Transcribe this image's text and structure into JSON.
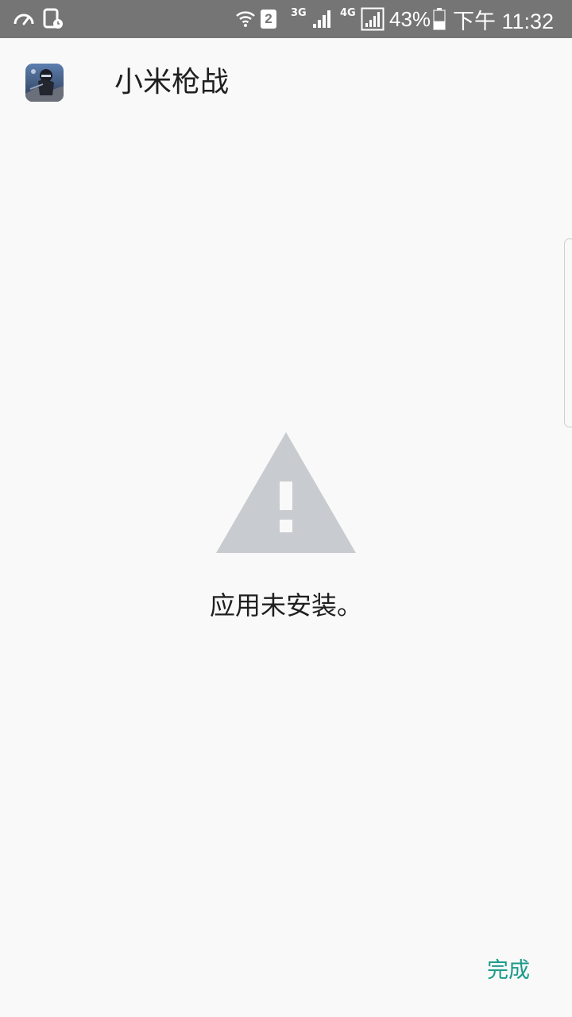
{
  "status_bar": {
    "sim_slot": "2",
    "network_1": "3G",
    "network_2": "4G",
    "battery_percent": "43%",
    "battery_level": 0.43,
    "time": "下午 11:32"
  },
  "header": {
    "app_name": "小米枪战"
  },
  "main": {
    "message": "应用未安装。"
  },
  "footer": {
    "done_label": "完成"
  },
  "colors": {
    "status_bar_bg": "#757575",
    "page_bg": "#f9f9f9",
    "warning_icon": "#c8cbcf",
    "accent": "#1a9a8b"
  }
}
